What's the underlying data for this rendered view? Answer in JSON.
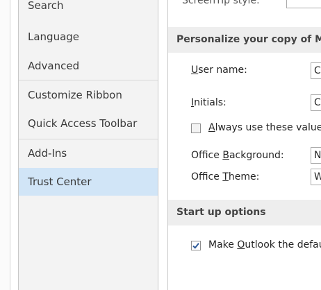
{
  "sidebar": {
    "items": [
      {
        "label": "Search"
      },
      {
        "label": "Language"
      },
      {
        "label": "Advanced"
      },
      {
        "label": "Customize Ribbon"
      },
      {
        "label": "Quick Access Toolbar"
      },
      {
        "label": "Add-Ins"
      },
      {
        "label": "Trust Center"
      }
    ],
    "selected_index": 6
  },
  "main": {
    "top_partial": {
      "label": "ScreenTip style:"
    },
    "personalize": {
      "title": "Personalize your copy of Microsoft Office",
      "user_name": {
        "pre": "",
        "key": "U",
        "post": "ser name:",
        "value": "C"
      },
      "initials": {
        "pre": "",
        "key": "I",
        "post": "nitials:",
        "value": "C"
      },
      "always_use": {
        "pre": "",
        "key": "A",
        "post": "lways use these values regardless of sign in to Office.",
        "checked": false
      },
      "office_background": {
        "pre": "Office ",
        "key": "B",
        "post": "ackground:",
        "value": "N"
      },
      "office_theme": {
        "pre": "Office ",
        "key": "T",
        "post": "heme:",
        "value": "W"
      }
    },
    "startup": {
      "title": "Start up options",
      "make_default": {
        "pre": "Make ",
        "key": "O",
        "post": "utlook the default program for E-mail, Contacts, and Calendar",
        "checked": true
      }
    }
  },
  "colors": {
    "selected_bg": "#d1e5f7",
    "section_bg": "#eeeeee",
    "check": "#2b5797"
  }
}
